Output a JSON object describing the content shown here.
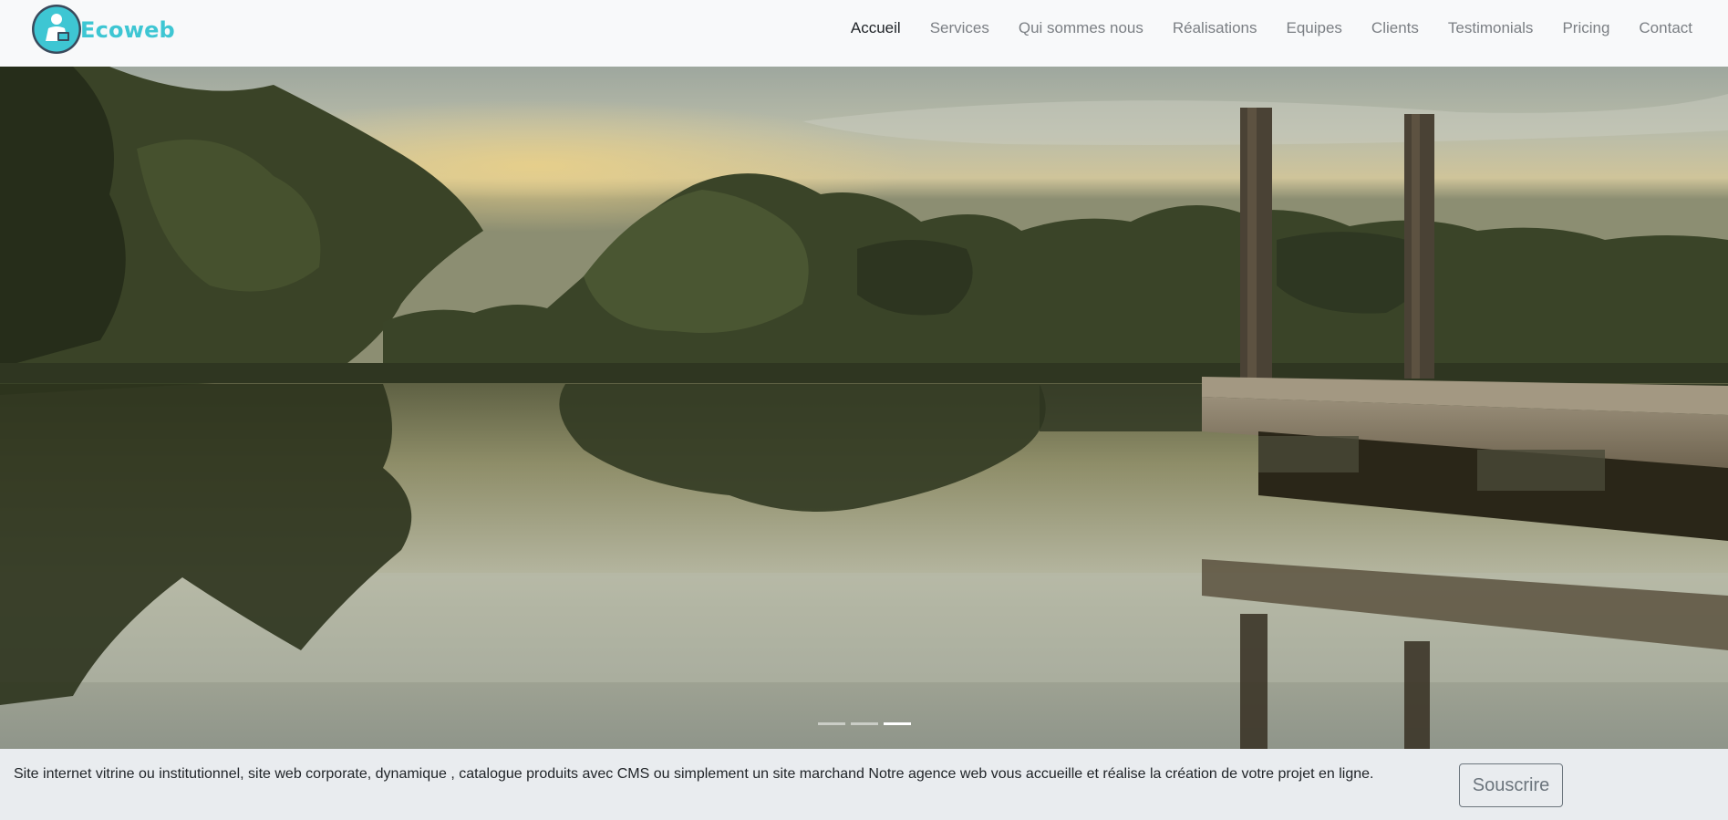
{
  "brand": {
    "name": "Ecoweb",
    "logo_colors": {
      "ring": "#3a4a5c",
      "fill": "#3ec6d3",
      "figure": "#ffffff"
    }
  },
  "nav": {
    "items": [
      {
        "label": "Accueil",
        "active": true
      },
      {
        "label": "Services"
      },
      {
        "label": "Qui sommes nous"
      },
      {
        "label": "Réalisations"
      },
      {
        "label": "Equipes"
      },
      {
        "label": "Clients"
      },
      {
        "label": "Testimonials"
      },
      {
        "label": "Pricing"
      },
      {
        "label": "Contact"
      }
    ]
  },
  "carousel": {
    "slide_count": 3,
    "active_slide": 3,
    "image_description_name": "lake-dock-sunrise-photo"
  },
  "cta": {
    "text": "Site internet vitrine ou institutionnel, site web corporate, dynamique , catalogue produits avec CMS ou simplement un site marchand Notre agence web vous accueille et réalise la création de votre projet en ligne.",
    "button_label": "Souscrire"
  }
}
